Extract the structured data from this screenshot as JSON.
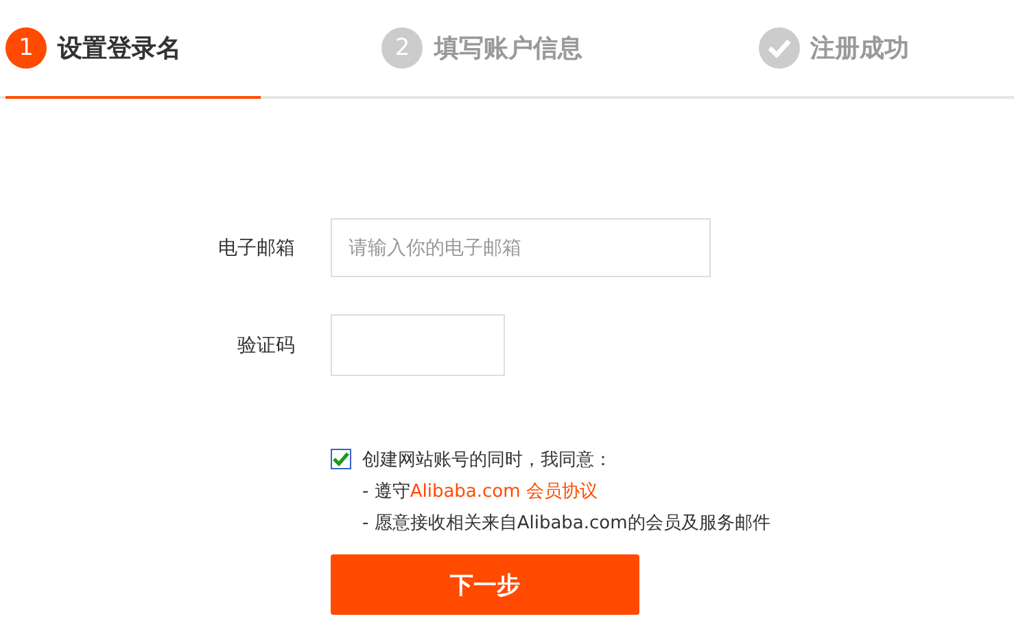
{
  "steps": [
    {
      "kind": "number",
      "marker": "1",
      "label": "设置登录名",
      "selected": true
    },
    {
      "kind": "number",
      "marker": "2",
      "label": "填写账户信息",
      "selected": false
    },
    {
      "kind": "check",
      "label": "注册成功",
      "selected": false
    }
  ],
  "form": {
    "fields": [
      {
        "label": "电子邮箱",
        "placeholder": "请输入你的电子邮箱",
        "kind": "wide"
      },
      {
        "label": "验证码",
        "kind": "short"
      }
    ]
  },
  "agreement": {
    "checked": true,
    "title": "创建网站账号的同时，我同意：",
    "terms_prefix": "- 遵守",
    "terms_link": "Alibaba.com 会员协议",
    "email_line": "- 愿意接收相关来自Alibaba.com的会员及服务邮件"
  },
  "next_button": "下一步"
}
